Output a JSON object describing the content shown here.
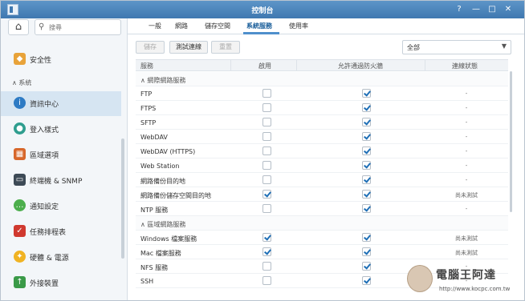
{
  "window": {
    "title": "控制台",
    "help": "?",
    "minimize": "—",
    "maximize": "□",
    "close": "✕"
  },
  "sidebar": {
    "search_placeholder": "搜尋",
    "section_system": "系統",
    "items": [
      {
        "label": "安全性",
        "icon": "shield-icon",
        "color": "#e8a33a"
      },
      {
        "label": "資訊中心",
        "icon": "info-icon",
        "color": "#2e7bc4",
        "active": true
      },
      {
        "label": "登入樣式",
        "icon": "palette-icon",
        "color": "#2f9e8f"
      },
      {
        "label": "區域選項",
        "icon": "calendar-icon",
        "color": "#d7672b"
      },
      {
        "label": "終端機 & SNMP",
        "icon": "terminal-icon",
        "color": "#3d4a56"
      },
      {
        "label": "通知設定",
        "icon": "chat-icon",
        "color": "#4cae4c"
      },
      {
        "label": "任務排程表",
        "icon": "schedule-icon",
        "color": "#d0392f"
      },
      {
        "label": "硬體 & 電源",
        "icon": "bulb-icon",
        "color": "#f0b323"
      },
      {
        "label": "外接裝置",
        "icon": "upload-icon",
        "color": "#3a9a48"
      }
    ]
  },
  "tabs": [
    "一般",
    "網路",
    "儲存空間",
    "系統服務",
    "使用率"
  ],
  "toolbar": {
    "save": "儲存",
    "test": "測試連線",
    "reset": "重置",
    "filter": "全部"
  },
  "table": {
    "headers": {
      "service": "服務",
      "enable": "啟用",
      "firewall": "允許通過防火牆",
      "status": "連線狀態"
    },
    "groups": [
      {
        "label": "網際網路服務",
        "rows": [
          {
            "name": "FTP",
            "enabled": false,
            "firewall": true,
            "status": "-"
          },
          {
            "name": "FTPS",
            "enabled": false,
            "firewall": true,
            "status": "-"
          },
          {
            "name": "SFTP",
            "enabled": false,
            "firewall": true,
            "status": "-"
          },
          {
            "name": "WebDAV",
            "enabled": false,
            "firewall": true,
            "status": "-"
          },
          {
            "name": "WebDAV (HTTPS)",
            "enabled": false,
            "firewall": true,
            "status": "-"
          },
          {
            "name": "Web Station",
            "enabled": false,
            "firewall": true,
            "status": "-"
          },
          {
            "name": "網路備份目的地",
            "enabled": false,
            "firewall": true,
            "status": "-"
          },
          {
            "name": "網路備份儲存空間目的地",
            "enabled": true,
            "firewall": true,
            "status": "尚未測試"
          },
          {
            "name": "NTP 服務",
            "enabled": false,
            "firewall": true,
            "status": "-"
          }
        ]
      },
      {
        "label": "區域網路服務",
        "rows": [
          {
            "name": "Windows 檔案服務",
            "enabled": true,
            "firewall": true,
            "status": "尚未測試"
          },
          {
            "name": "Mac 檔案服務",
            "enabled": true,
            "firewall": true,
            "status": "尚未測試"
          },
          {
            "name": "NFS 服務",
            "enabled": false,
            "firewall": true,
            "status": "-"
          },
          {
            "name": "SSH",
            "enabled": false,
            "firewall": true,
            "status": "-"
          }
        ]
      }
    ]
  },
  "watermark": {
    "title": "電腦王阿達",
    "url": "http://www.kocpc.com.tw"
  }
}
